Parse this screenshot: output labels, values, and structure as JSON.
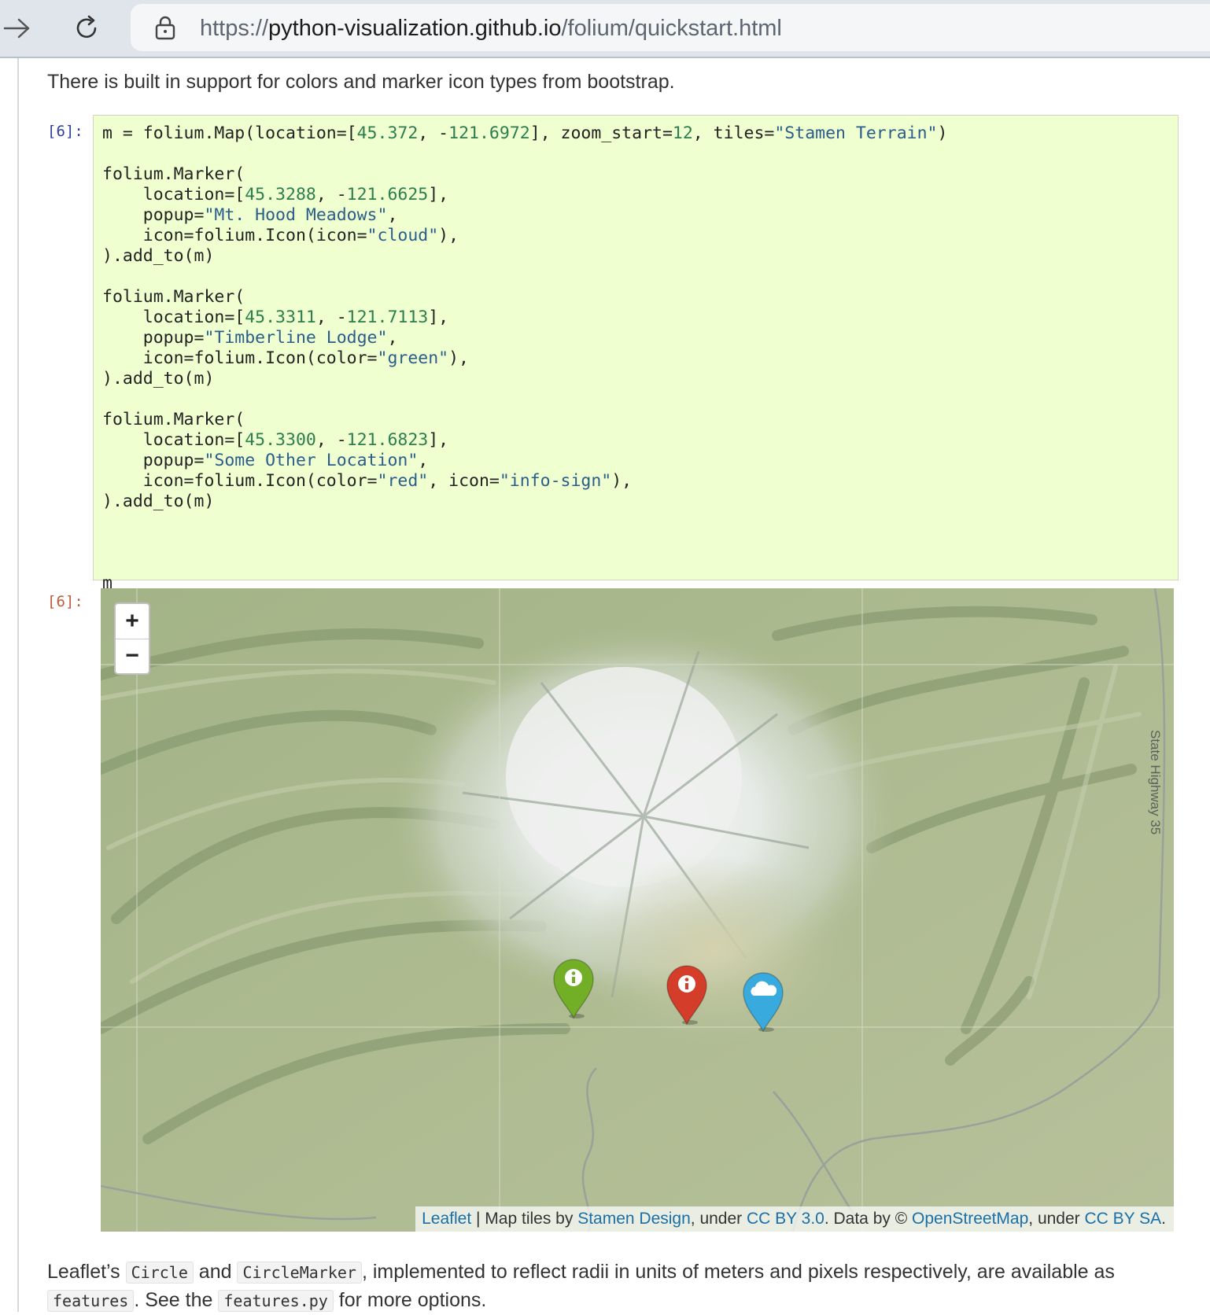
{
  "browser": {
    "url_prefix": "https://",
    "url_host": "python-visualization.github.io",
    "url_path": "/folium/quickstart.html"
  },
  "intro_text": "There is built in support for colors and marker icon types from bootstrap.",
  "cell": {
    "in_prompt": "[6]:",
    "out_prompt": "[6]:"
  },
  "code_lines": [
    [
      [
        "m = folium.Map(location=[",
        ""
      ],
      [
        "45.372",
        "n"
      ],
      [
        ", -",
        ""
      ],
      [
        "121.6972",
        "n"
      ],
      [
        "], zoom_start=",
        ""
      ],
      [
        "12",
        "n"
      ],
      [
        ", tiles=",
        ""
      ],
      [
        "\"Stamen Terrain\"",
        "s"
      ],
      [
        ")",
        ""
      ]
    ],
    [
      [
        "",
        ""
      ]
    ],
    [
      [
        "folium.Marker(",
        ""
      ]
    ],
    [
      [
        "    location=[",
        ""
      ],
      [
        "45.3288",
        "n"
      ],
      [
        ", -",
        ""
      ],
      [
        "121.6625",
        "n"
      ],
      [
        "],",
        ""
      ]
    ],
    [
      [
        "    popup=",
        ""
      ],
      [
        "\"Mt. Hood Meadows\"",
        "s"
      ],
      [
        ",",
        ""
      ]
    ],
    [
      [
        "    icon=folium.Icon(icon=",
        ""
      ],
      [
        "\"cloud\"",
        "s"
      ],
      [
        "),",
        ""
      ]
    ],
    [
      [
        ").add_to(m)",
        ""
      ]
    ],
    [
      [
        "",
        ""
      ]
    ],
    [
      [
        "folium.Marker(",
        ""
      ]
    ],
    [
      [
        "    location=[",
        ""
      ],
      [
        "45.3311",
        "n"
      ],
      [
        ", -",
        ""
      ],
      [
        "121.7113",
        "n"
      ],
      [
        "],",
        ""
      ]
    ],
    [
      [
        "    popup=",
        ""
      ],
      [
        "\"Timberline Lodge\"",
        "s"
      ],
      [
        ",",
        ""
      ]
    ],
    [
      [
        "    icon=folium.Icon(color=",
        ""
      ],
      [
        "\"green\"",
        "s"
      ],
      [
        "),",
        ""
      ]
    ],
    [
      [
        ").add_to(m)",
        ""
      ]
    ],
    [
      [
        "",
        ""
      ]
    ],
    [
      [
        "folium.Marker(",
        ""
      ]
    ],
    [
      [
        "    location=[",
        ""
      ],
      [
        "45.3300",
        "n"
      ],
      [
        ", -",
        ""
      ],
      [
        "121.6823",
        "n"
      ],
      [
        "],",
        ""
      ]
    ],
    [
      [
        "    popup=",
        ""
      ],
      [
        "\"Some Other Location\"",
        "s"
      ],
      [
        ",",
        ""
      ]
    ],
    [
      [
        "    icon=folium.Icon(color=",
        ""
      ],
      [
        "\"red\"",
        "s"
      ],
      [
        ", icon=",
        ""
      ],
      [
        "\"info-sign\"",
        "s"
      ],
      [
        "),",
        ""
      ]
    ],
    [
      [
        ").add_to(m)",
        ""
      ]
    ],
    [
      [
        "",
        ""
      ]
    ],
    [
      [
        "",
        ""
      ]
    ],
    [
      [
        "",
        ""
      ]
    ],
    [
      [
        "m",
        ""
      ]
    ]
  ],
  "map": {
    "zoom_in": "+",
    "zoom_out": "−",
    "road_label": "State Highway 35",
    "markers": [
      {
        "name": "timberline-lodge-marker",
        "color": "#72af26",
        "icon": "info-sign-icon"
      },
      {
        "name": "some-other-location-marker",
        "color": "#d33d29",
        "icon": "info-sign-icon"
      },
      {
        "name": "mt-hood-meadows-marker",
        "color": "#38aadd",
        "icon": "cloud-icon"
      }
    ],
    "attribution": {
      "leaflet": "Leaflet",
      "sep1": " | Map tiles by ",
      "stamen": "Stamen Design",
      "sep2": ", under ",
      "ccby": "CC BY 3.0",
      "sep3": ". Data by © ",
      "osm": "OpenStreetMap",
      "sep4": ", under ",
      "ccbysa": "CC BY SA",
      "end": "."
    }
  },
  "paragraph": {
    "t1": "Leaflet’s ",
    "c1": "Circle",
    "t2": " and ",
    "c2": "CircleMarker",
    "t3": ", implemented to reflect radii in units of meters and pixels respectively, are available as ",
    "c3": "features",
    "t4": ". See the ",
    "c4": "features.py",
    "t5": " for more options."
  },
  "colors": {
    "code_bg": "#efffd0",
    "in_prompt": "#303f9f",
    "out_prompt": "#bf5b3d",
    "link": "#1a6fa8"
  }
}
